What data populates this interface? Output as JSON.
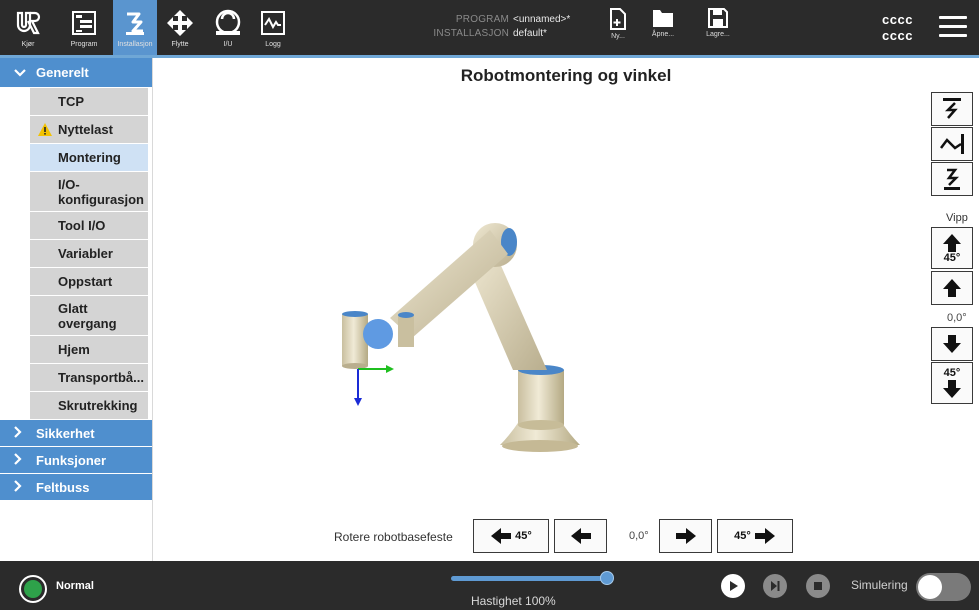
{
  "topbar": {
    "nav": [
      {
        "label": "Kjør",
        "icon": "ur-logo-icon"
      },
      {
        "label": "Program",
        "icon": "program-icon"
      },
      {
        "label": "Installasjon",
        "icon": "installation-icon"
      },
      {
        "label": "Flytte",
        "icon": "move-icon"
      },
      {
        "label": "I/U",
        "icon": "io-icon"
      },
      {
        "label": "Logg",
        "icon": "log-icon"
      }
    ],
    "program_key": "PROGRAM",
    "program_value": "<unnamed>*",
    "installation_key": "INSTALLASJON",
    "installation_value": "default*",
    "file_buttons": [
      {
        "label": "Ny...",
        "icon": "new-file-icon"
      },
      {
        "label": "Åpne...",
        "icon": "folder-icon"
      },
      {
        "label": "Lagre...",
        "icon": "save-icon"
      }
    ],
    "user_line1": "cccc",
    "user_line2": "cccc"
  },
  "sidebar": {
    "sections": [
      {
        "label": "Generelt",
        "expanded": true
      },
      {
        "label": "Sikkerhet",
        "expanded": false
      },
      {
        "label": "Funksjoner",
        "expanded": false
      },
      {
        "label": "Feltbuss",
        "expanded": false
      }
    ],
    "items": [
      {
        "label": "TCP"
      },
      {
        "label": "Nyttelast",
        "warning": true
      },
      {
        "label": "Montering",
        "selected": true
      },
      {
        "label": "I/O-konfigurasjon",
        "line1": "I/O-",
        "line2": "konfigurasjon"
      },
      {
        "label": "Tool I/O"
      },
      {
        "label": "Variabler"
      },
      {
        "label": "Oppstart"
      },
      {
        "label": "Glatt overgang",
        "line1": "Glatt",
        "line2": "overgang"
      },
      {
        "label": "Hjem"
      },
      {
        "label": "Transportbå..."
      },
      {
        "label": "Skrutrekking"
      }
    ]
  },
  "main": {
    "title": "Robotmontering og vinkel",
    "vipp_label": "Vipp",
    "vipp_up45": "45°",
    "vipp_value": "0,0°",
    "vipp_down45": "45°",
    "rotate_label": "Rotere robotbasefeste",
    "rotate_left45": "45°",
    "rotate_value": "0,0°",
    "rotate_right45": "45°"
  },
  "bottombar": {
    "status": "Normal",
    "status_color": "#2ea24a",
    "speed_label": "Hastighet 100%",
    "speed_percent": 100,
    "simulation_label": "Simulering",
    "simulation_on": false
  },
  "colors": {
    "accent": "#5a95cf",
    "bar_bg": "#2b2b2b",
    "robot_body": "#d9cfb4",
    "robot_joint_cap": "#4a86c8"
  }
}
